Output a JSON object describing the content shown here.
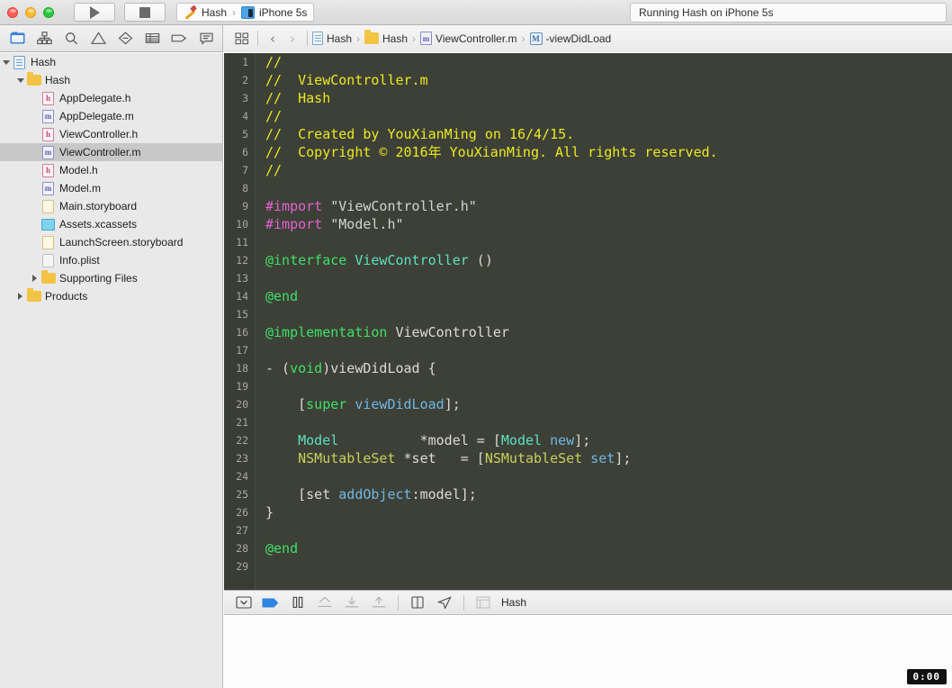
{
  "titlebar": {
    "run_icon": "play-icon",
    "stop_icon": "stop-icon",
    "scheme_name": "Hash",
    "scheme_separator": "›",
    "destination": "iPhone 5s",
    "status_text": "Running Hash on iPhone 5s"
  },
  "navigator_toolbar": {
    "icons": [
      {
        "name": "project-navigator-icon",
        "selected": true
      },
      {
        "name": "symbol-navigator-icon",
        "selected": false
      },
      {
        "name": "find-navigator-icon",
        "selected": false
      },
      {
        "name": "issue-navigator-icon",
        "selected": false
      },
      {
        "name": "test-navigator-icon",
        "selected": false
      },
      {
        "name": "debug-navigator-icon",
        "selected": false
      },
      {
        "name": "breakpoint-navigator-icon",
        "selected": false
      },
      {
        "name": "report-navigator-icon",
        "selected": false
      }
    ]
  },
  "breadcrumb": {
    "grid_icon": "related-items-icon",
    "back_arrow": "‹",
    "forward_arrow": "›",
    "separator": "›",
    "items": [
      {
        "label": "Hash",
        "icon": "project-icon"
      },
      {
        "label": "Hash",
        "icon": "folder-icon"
      },
      {
        "label": "ViewController.m",
        "icon": "objc-m-icon",
        "badge": "m"
      },
      {
        "label": "-viewDidLoad",
        "icon": "method-icon",
        "badge": "M"
      }
    ]
  },
  "sidebar": {
    "rows": [
      {
        "label": "Hash",
        "indent": 0,
        "disclosure": "down",
        "icon": "project-icon",
        "selected": false
      },
      {
        "label": "Hash",
        "indent": 1,
        "disclosure": "down",
        "icon": "folder-icon",
        "selected": false
      },
      {
        "label": "AppDelegate.h",
        "indent": 2,
        "disclosure": "none",
        "icon": "header-icon",
        "badge": "h",
        "selected": false
      },
      {
        "label": "AppDelegate.m",
        "indent": 2,
        "disclosure": "none",
        "icon": "objc-m-icon",
        "badge": "m",
        "selected": false
      },
      {
        "label": "ViewController.h",
        "indent": 2,
        "disclosure": "none",
        "icon": "header-icon",
        "badge": "h",
        "selected": false
      },
      {
        "label": "ViewController.m",
        "indent": 2,
        "disclosure": "none",
        "icon": "objc-m-icon",
        "badge": "m",
        "selected": true
      },
      {
        "label": "Model.h",
        "indent": 2,
        "disclosure": "none",
        "icon": "header-icon",
        "badge": "h",
        "selected": false
      },
      {
        "label": "Model.m",
        "indent": 2,
        "disclosure": "none",
        "icon": "objc-m-icon",
        "badge": "m",
        "selected": false
      },
      {
        "label": "Main.storyboard",
        "indent": 2,
        "disclosure": "none",
        "icon": "storyboard-icon",
        "selected": false
      },
      {
        "label": "Assets.xcassets",
        "indent": 2,
        "disclosure": "none",
        "icon": "assets-icon",
        "selected": false
      },
      {
        "label": "LaunchScreen.storyboard",
        "indent": 2,
        "disclosure": "none",
        "icon": "storyboard-icon",
        "selected": false
      },
      {
        "label": "Info.plist",
        "indent": 2,
        "disclosure": "none",
        "icon": "plist-icon",
        "selected": false
      },
      {
        "label": "Supporting Files",
        "indent": 2,
        "disclosure": "right",
        "icon": "folder-icon",
        "selected": false
      },
      {
        "label": "Products",
        "indent": 1,
        "disclosure": "right",
        "icon": "folder-icon",
        "selected": false
      }
    ]
  },
  "editor": {
    "first_line": 1,
    "line_count": 29,
    "lines": [
      {
        "n": 1,
        "tokens": [
          {
            "t": "//",
            "c": "cmt"
          }
        ]
      },
      {
        "n": 2,
        "tokens": [
          {
            "t": "//  ViewController.m",
            "c": "cmt"
          }
        ]
      },
      {
        "n": 3,
        "tokens": [
          {
            "t": "//  Hash",
            "c": "cmt"
          }
        ]
      },
      {
        "n": 4,
        "tokens": [
          {
            "t": "//",
            "c": "cmt"
          }
        ]
      },
      {
        "n": 5,
        "tokens": [
          {
            "t": "//  Created by YouXianMing on 16/4/15.",
            "c": "cmt"
          }
        ]
      },
      {
        "n": 6,
        "tokens": [
          {
            "t": "//  Copyright © 2016年 YouXianMing. All rights reserved.",
            "c": "cmt"
          }
        ]
      },
      {
        "n": 7,
        "tokens": [
          {
            "t": "//",
            "c": "cmt"
          }
        ]
      },
      {
        "n": 8,
        "tokens": []
      },
      {
        "n": 9,
        "tokens": [
          {
            "t": "#import",
            "c": "pre"
          },
          {
            "t": " ",
            "c": "plain"
          },
          {
            "t": "\"ViewController.h\"",
            "c": "str"
          }
        ]
      },
      {
        "n": 10,
        "tokens": [
          {
            "t": "#import",
            "c": "pre"
          },
          {
            "t": " ",
            "c": "plain"
          },
          {
            "t": "\"Model.h\"",
            "c": "str"
          }
        ]
      },
      {
        "n": 11,
        "tokens": []
      },
      {
        "n": 12,
        "tokens": [
          {
            "t": "@interface",
            "c": "kw"
          },
          {
            "t": " ",
            "c": "plain"
          },
          {
            "t": "ViewController",
            "c": "cls"
          },
          {
            "t": " ()",
            "c": "plain"
          }
        ]
      },
      {
        "n": 13,
        "tokens": []
      },
      {
        "n": 14,
        "tokens": [
          {
            "t": "@end",
            "c": "kw"
          }
        ]
      },
      {
        "n": 15,
        "tokens": []
      },
      {
        "n": 16,
        "tokens": [
          {
            "t": "@implementation",
            "c": "kw"
          },
          {
            "t": " ViewController",
            "c": "plain"
          }
        ]
      },
      {
        "n": 17,
        "tokens": []
      },
      {
        "n": 18,
        "tokens": [
          {
            "t": "- (",
            "c": "plain"
          },
          {
            "t": "void",
            "c": "kw"
          },
          {
            "t": ")viewDidLoad {",
            "c": "plain"
          }
        ]
      },
      {
        "n": 19,
        "tokens": []
      },
      {
        "n": 20,
        "tokens": [
          {
            "t": "    [",
            "c": "plain"
          },
          {
            "t": "super",
            "c": "kw"
          },
          {
            "t": " ",
            "c": "plain"
          },
          {
            "t": "viewDidLoad",
            "c": "call"
          },
          {
            "t": "];",
            "c": "plain"
          }
        ]
      },
      {
        "n": 21,
        "tokens": []
      },
      {
        "n": 22,
        "tokens": [
          {
            "t": "    ",
            "c": "plain"
          },
          {
            "t": "Model",
            "c": "cls"
          },
          {
            "t": "          *model = [",
            "c": "plain"
          },
          {
            "t": "Model",
            "c": "cls"
          },
          {
            "t": " ",
            "c": "plain"
          },
          {
            "t": "new",
            "c": "call"
          },
          {
            "t": "];",
            "c": "plain"
          }
        ]
      },
      {
        "n": 23,
        "tokens": [
          {
            "t": "    ",
            "c": "plain"
          },
          {
            "t": "NSMutableSet",
            "c": "sys"
          },
          {
            "t": " *set   = [",
            "c": "plain"
          },
          {
            "t": "NSMutableSet",
            "c": "sys"
          },
          {
            "t": " ",
            "c": "plain"
          },
          {
            "t": "set",
            "c": "call"
          },
          {
            "t": "];",
            "c": "plain"
          }
        ]
      },
      {
        "n": 24,
        "tokens": []
      },
      {
        "n": 25,
        "tokens": [
          {
            "t": "    [set ",
            "c": "plain"
          },
          {
            "t": "addObject",
            "c": "call"
          },
          {
            "t": ":model];",
            "c": "plain"
          }
        ]
      },
      {
        "n": 26,
        "tokens": [
          {
            "t": "}",
            "c": "plain"
          }
        ]
      },
      {
        "n": 27,
        "tokens": []
      },
      {
        "n": 28,
        "tokens": [
          {
            "t": "@end",
            "c": "kw"
          }
        ]
      },
      {
        "n": 29,
        "tokens": []
      }
    ]
  },
  "debug_bar": {
    "icons": [
      {
        "name": "hide-debug-area-icon"
      },
      {
        "name": "deactivate-breakpoints-icon"
      },
      {
        "name": "pause-continue-icon"
      },
      {
        "name": "step-over-icon"
      },
      {
        "name": "step-into-icon"
      },
      {
        "name": "step-out-icon"
      },
      {
        "name": "simulate-location-icon"
      },
      {
        "name": "debug-view-hierarchy-icon"
      },
      {
        "name": "stack-frame-icon"
      }
    ],
    "process_label": "Hash"
  },
  "console": {
    "timer": "0:00"
  },
  "colors": {
    "editor_background": "#3d4036",
    "gutter_background": "#3a3d34",
    "comment": "#eaea22",
    "preprocessor": "#e362d4",
    "string": "#cfd5d6",
    "keyword": "#3ee06a",
    "user_class": "#5ce0c4",
    "system_class": "#c8d05c",
    "method_call": "#71b7e6",
    "plain_text": "#dcdcd6",
    "selection": "#c8c8c8",
    "accent": "#3b82d6"
  }
}
